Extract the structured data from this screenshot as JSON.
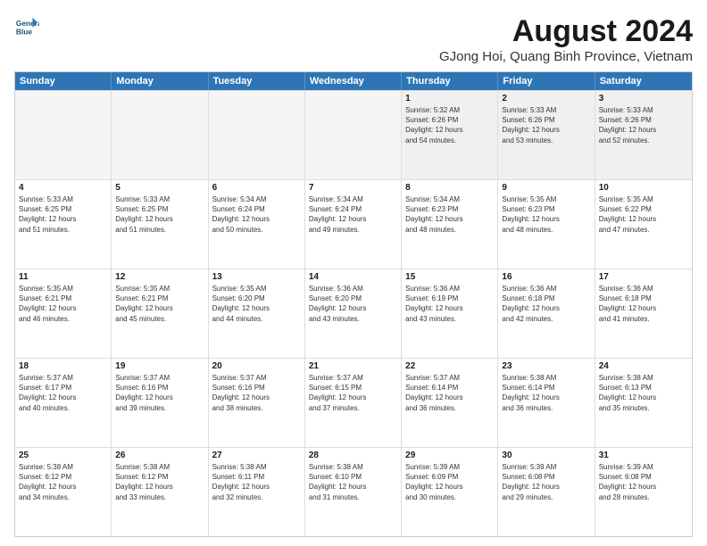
{
  "logo": {
    "line1": "General",
    "line2": "Blue"
  },
  "title": "August 2024",
  "subtitle": "GJong Hoi, Quang Binh Province, Vietnam",
  "weekdays": [
    "Sunday",
    "Monday",
    "Tuesday",
    "Wednesday",
    "Thursday",
    "Friday",
    "Saturday"
  ],
  "weeks": [
    [
      {
        "day": "",
        "text": "",
        "empty": true
      },
      {
        "day": "",
        "text": "",
        "empty": true
      },
      {
        "day": "",
        "text": "",
        "empty": true
      },
      {
        "day": "",
        "text": "",
        "empty": true
      },
      {
        "day": "1",
        "text": "Sunrise: 5:32 AM\nSunset: 6:26 PM\nDaylight: 12 hours\nand 54 minutes."
      },
      {
        "day": "2",
        "text": "Sunrise: 5:33 AM\nSunset: 6:26 PM\nDaylight: 12 hours\nand 53 minutes."
      },
      {
        "day": "3",
        "text": "Sunrise: 5:33 AM\nSunset: 6:26 PM\nDaylight: 12 hours\nand 52 minutes."
      }
    ],
    [
      {
        "day": "4",
        "text": "Sunrise: 5:33 AM\nSunset: 6:25 PM\nDaylight: 12 hours\nand 51 minutes."
      },
      {
        "day": "5",
        "text": "Sunrise: 5:33 AM\nSunset: 6:25 PM\nDaylight: 12 hours\nand 51 minutes."
      },
      {
        "day": "6",
        "text": "Sunrise: 5:34 AM\nSunset: 6:24 PM\nDaylight: 12 hours\nand 50 minutes."
      },
      {
        "day": "7",
        "text": "Sunrise: 5:34 AM\nSunset: 6:24 PM\nDaylight: 12 hours\nand 49 minutes."
      },
      {
        "day": "8",
        "text": "Sunrise: 5:34 AM\nSunset: 6:23 PM\nDaylight: 12 hours\nand 48 minutes."
      },
      {
        "day": "9",
        "text": "Sunrise: 5:35 AM\nSunset: 6:23 PM\nDaylight: 12 hours\nand 48 minutes."
      },
      {
        "day": "10",
        "text": "Sunrise: 5:35 AM\nSunset: 6:22 PM\nDaylight: 12 hours\nand 47 minutes."
      }
    ],
    [
      {
        "day": "11",
        "text": "Sunrise: 5:35 AM\nSunset: 6:21 PM\nDaylight: 12 hours\nand 46 minutes."
      },
      {
        "day": "12",
        "text": "Sunrise: 5:35 AM\nSunset: 6:21 PM\nDaylight: 12 hours\nand 45 minutes."
      },
      {
        "day": "13",
        "text": "Sunrise: 5:35 AM\nSunset: 6:20 PM\nDaylight: 12 hours\nand 44 minutes."
      },
      {
        "day": "14",
        "text": "Sunrise: 5:36 AM\nSunset: 6:20 PM\nDaylight: 12 hours\nand 43 minutes."
      },
      {
        "day": "15",
        "text": "Sunrise: 5:36 AM\nSunset: 6:19 PM\nDaylight: 12 hours\nand 43 minutes."
      },
      {
        "day": "16",
        "text": "Sunrise: 5:36 AM\nSunset: 6:18 PM\nDaylight: 12 hours\nand 42 minutes."
      },
      {
        "day": "17",
        "text": "Sunrise: 5:36 AM\nSunset: 6:18 PM\nDaylight: 12 hours\nand 41 minutes."
      }
    ],
    [
      {
        "day": "18",
        "text": "Sunrise: 5:37 AM\nSunset: 6:17 PM\nDaylight: 12 hours\nand 40 minutes."
      },
      {
        "day": "19",
        "text": "Sunrise: 5:37 AM\nSunset: 6:16 PM\nDaylight: 12 hours\nand 39 minutes."
      },
      {
        "day": "20",
        "text": "Sunrise: 5:37 AM\nSunset: 6:16 PM\nDaylight: 12 hours\nand 38 minutes."
      },
      {
        "day": "21",
        "text": "Sunrise: 5:37 AM\nSunset: 6:15 PM\nDaylight: 12 hours\nand 37 minutes."
      },
      {
        "day": "22",
        "text": "Sunrise: 5:37 AM\nSunset: 6:14 PM\nDaylight: 12 hours\nand 36 minutes."
      },
      {
        "day": "23",
        "text": "Sunrise: 5:38 AM\nSunset: 6:14 PM\nDaylight: 12 hours\nand 36 minutes."
      },
      {
        "day": "24",
        "text": "Sunrise: 5:38 AM\nSunset: 6:13 PM\nDaylight: 12 hours\nand 35 minutes."
      }
    ],
    [
      {
        "day": "25",
        "text": "Sunrise: 5:38 AM\nSunset: 6:12 PM\nDaylight: 12 hours\nand 34 minutes."
      },
      {
        "day": "26",
        "text": "Sunrise: 5:38 AM\nSunset: 6:12 PM\nDaylight: 12 hours\nand 33 minutes."
      },
      {
        "day": "27",
        "text": "Sunrise: 5:38 AM\nSunset: 6:11 PM\nDaylight: 12 hours\nand 32 minutes."
      },
      {
        "day": "28",
        "text": "Sunrise: 5:38 AM\nSunset: 6:10 PM\nDaylight: 12 hours\nand 31 minutes."
      },
      {
        "day": "29",
        "text": "Sunrise: 5:39 AM\nSunset: 6:09 PM\nDaylight: 12 hours\nand 30 minutes."
      },
      {
        "day": "30",
        "text": "Sunrise: 5:39 AM\nSunset: 6:08 PM\nDaylight: 12 hours\nand 29 minutes."
      },
      {
        "day": "31",
        "text": "Sunrise: 5:39 AM\nSunset: 6:08 PM\nDaylight: 12 hours\nand 28 minutes."
      }
    ]
  ]
}
